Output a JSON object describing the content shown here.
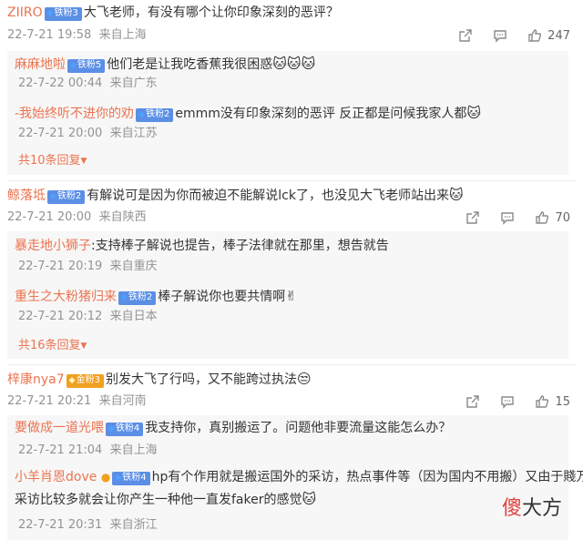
{
  "comments": [
    {
      "user": "ZIIRO",
      "badge": "铁粉3",
      "text": "大飞老师，有没有哪个让你印象深刻的恶评？",
      "date": "22-7-21 19:58",
      "location": "来自上海",
      "likes": "247",
      "replies": [
        {
          "user": "麻麻地啦",
          "badge": "铁粉5",
          "text": "他们老是让我吃香蕉我很困惑",
          "emoji": "🐱🐱🐱",
          "date": "22-7-22 00:44",
          "location": "来自广东"
        },
        {
          "user": "-我始终听不进你的劝",
          "badge": "铁粉2",
          "text": "emmm没有印象深刻的恶评  反正都是问候我家人都",
          "emoji": "🐱",
          "date": "22-7-21 20:00",
          "location": "来自江苏"
        }
      ],
      "more_replies": "共10条回复"
    },
    {
      "user": "鲸落坻",
      "badge": "铁粉2",
      "text": "有解说可是因为你而被迫不能解说lck了，也没见大飞老师站出来",
      "emoji": "🐱",
      "date": "22-7-21 20:00",
      "location": "来自陕西",
      "likes": "70",
      "replies": [
        {
          "user": "暴走地小狮子",
          "badge": "",
          "text": "支持棒子解说也提告，棒子法律就在那里，想告就告",
          "emoji": "",
          "date": "22-7-21 20:19",
          "location": "来自重庆"
        },
        {
          "user": "重生之大粉猪归来",
          "badge": "铁粉2",
          "text": "棒子解说你也要共情啊",
          "emoji": "✌",
          "date": "22-7-21 20:12",
          "location": "来自日本"
        }
      ],
      "more_replies": "共16条回复"
    },
    {
      "user": "梓康nya7",
      "badge": "金粉3",
      "text": "别发大飞了行吗，又不能跨过执法",
      "emoji": "😒",
      "date": "22-7-21 20:21",
      "location": "来自河南",
      "likes": "15",
      "replies": [
        {
          "user": "要做成一道光喂",
          "badge": "铁粉4",
          "text": "我支持你，真别搬运了。问题他非要流量这能怎么办？",
          "emoji": "",
          "date": "22-7-21 21:04",
          "location": "来自上海"
        },
        {
          "user": "小羊肖恩dove",
          "badge": "铁粉4",
          "text_line1": "hp有个作用就是搬运国外的采访，热点事件等（因为国内不用搬）又由于賤万",
          "text_line2": "采访比较多就会让你产生一种他一直发faker的感觉",
          "emoji": "🐱",
          "date": "22-7-21 20:31",
          "location": "来自浙江"
        }
      ]
    }
  ],
  "watermark": {
    "first": "傻",
    "rest": "大方"
  },
  "icons": {
    "share": "share-icon",
    "comment": "comment-icon",
    "like": "thumb-up-icon"
  },
  "colors": {
    "orange": "#eb7350",
    "meta_gray": "#939393",
    "badge_blue": "#5b8fe6",
    "badge_gold": "#f0a020"
  }
}
